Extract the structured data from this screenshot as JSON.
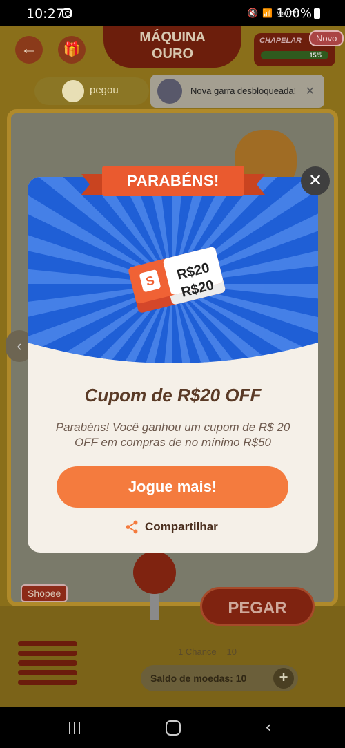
{
  "status_bar": {
    "time": "10:27",
    "battery": "100%",
    "signal_text": "Vo) LTE1"
  },
  "game": {
    "title_line1": "MÁQUINA",
    "title_line2": "OURO",
    "collection_label": "CHAPELAR",
    "collection_progress": "15/5",
    "new_badge": "Novo",
    "caught_label": "pegou",
    "toast_text": "Nova garra desbloqueada!",
    "brand_tag": "Shopee",
    "grab_button": "PEGAR",
    "chance_text": "1 Chance = 10",
    "balance_text": "Saldo de moedas: 10"
  },
  "modal": {
    "banner": "PARABÉNS!",
    "coupon_amount_1": "R$20",
    "coupon_amount_2": "R$20",
    "coupon_logo": "S",
    "title": "Cupom de R$20 OFF",
    "description": "Parabéns! Você ganhou um cupom de R$ 20 OFF em compras de no mínimo R$50",
    "play_button": "Jogue mais!",
    "share_label": "Compartilhar",
    "close_symbol": "✕"
  },
  "colors": {
    "accent": "#f47b3e",
    "hero_blue": "#1f5fd6",
    "banner": "#ea5a2f",
    "title_brown": "#5a3a26"
  },
  "icons": [
    "instagram-icon",
    "share-icon",
    "close-icon",
    "back-arrow-icon",
    "gift-icon"
  ]
}
